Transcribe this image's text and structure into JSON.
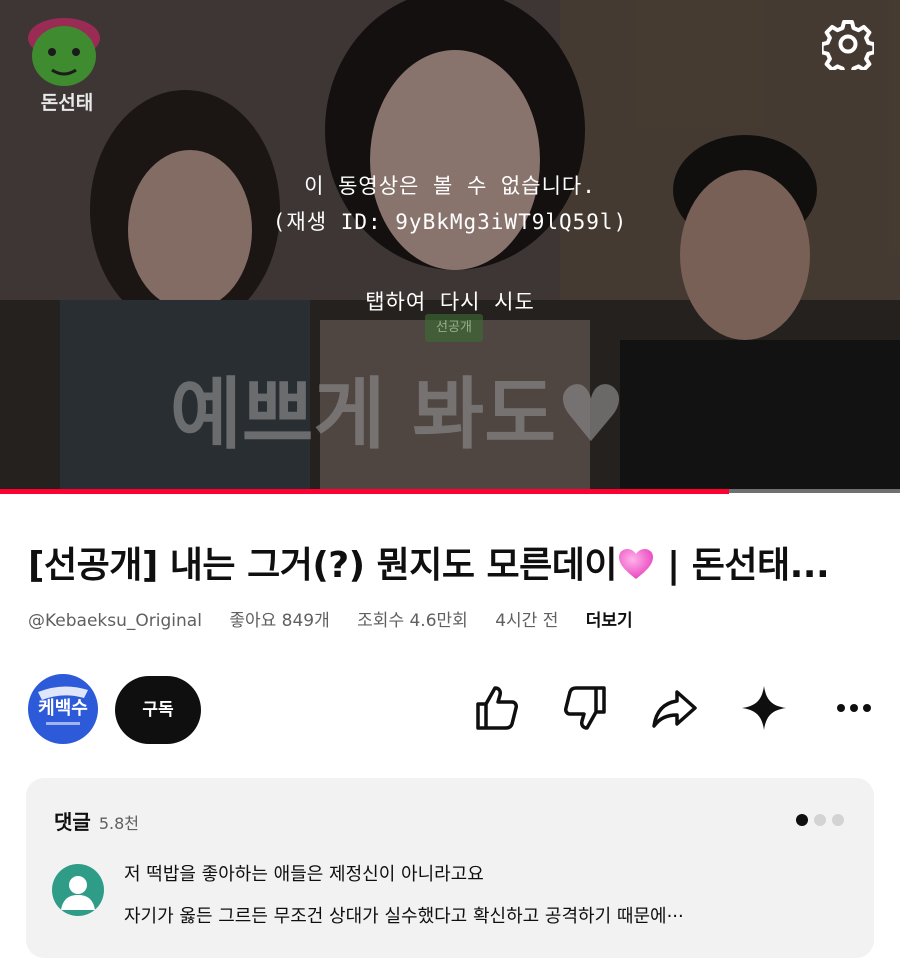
{
  "player": {
    "error_line1": "이 동영상은 볼 수 없습니다.",
    "error_line2": "(재생 ID: 9yBkMg3iWT9lQ59l)",
    "retry": "탭하여 다시 시도",
    "channel_logo_text": "돈선태",
    "caption_text": "예쁘게 봐도♥",
    "caption_tag": "선공개",
    "progress_fraction": 0.81,
    "progress_color": "#ff0033"
  },
  "video": {
    "title": "[선공개] 내는 그거(?) 뭔지도 모른데이",
    "title_suffix": " | 돈선태...",
    "title_emoji": "pink-heart-icon",
    "handle": "@Kebaeksu_Original",
    "likes": "좋아요 849개",
    "views": "조회수 4.6만회",
    "posted": "4시간 전",
    "more": "더보기"
  },
  "channel": {
    "avatar_text": "케백수",
    "subscribe_label": "구독"
  },
  "actions": {
    "icons": [
      "like-icon",
      "dislike-icon",
      "share-icon",
      "sparkle-icon",
      "more-horizontal-icon"
    ]
  },
  "comments": {
    "header": "댓글",
    "count": "5.8천",
    "pages": 3,
    "active_page": 1,
    "top_comment_line1": "저 떡밥을 좋아하는 애들은 제정신이 아니라고요",
    "top_comment_line2": "자기가 옳든 그르든 무조건 상대가 실수했다고 확신하고 공격하기 때문에···"
  }
}
